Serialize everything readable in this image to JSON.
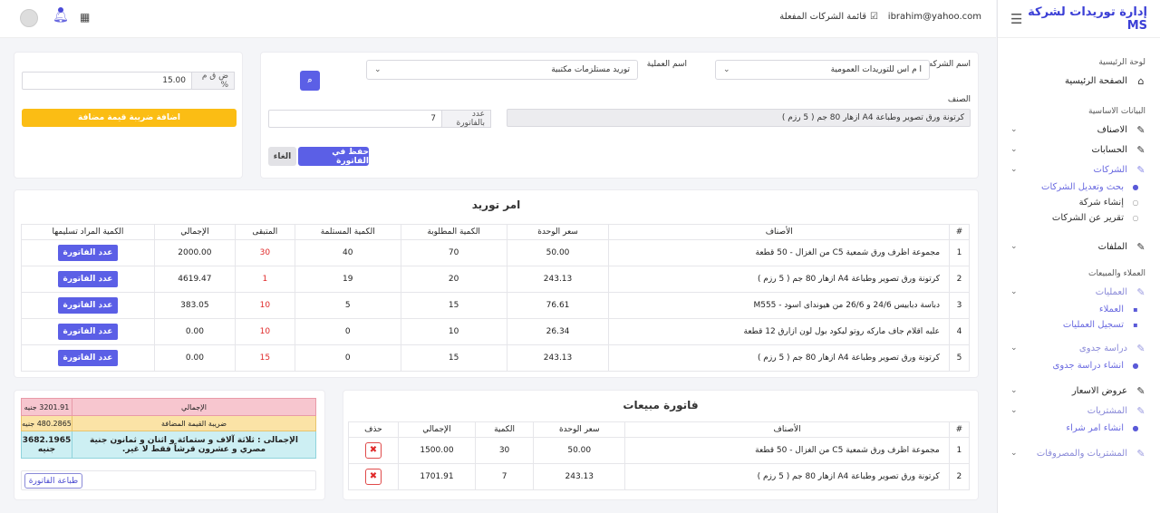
{
  "app": {
    "title": "إدارة توريدات لشركة MS"
  },
  "topbar": {
    "email": "ibrahim@yahoo.com",
    "companies_link": "قائمة الشركات المفعلة"
  },
  "sidebar": {
    "sections": [
      {
        "title": "لوحة الرئيسية"
      },
      {
        "title": "البيانات الاساسية"
      },
      {
        "title": "العملاء والمبيعات"
      }
    ],
    "home": "الصفحة الرئيسية",
    "items": {
      "categories": "الاصناف",
      "accounts": "الحسابات",
      "companies": "الشركات",
      "companies_search": "بحث وتعديل الشركات",
      "companies_create": "إنشاء شركة",
      "companies_report": "تقرير عن الشركات",
      "files": "الملفات",
      "operations": "العمليات",
      "clients": "العملاء",
      "register_ops": "تسجيل العمليات",
      "feasibility": "دراسة جدوى",
      "create_feasibility": "انشاء دراسة جدوى",
      "quotes": "عروض الاسعار",
      "purchases": "المشتريات",
      "create_po": "انشاء امر شراء",
      "purchases_expenses": "المشتريات والمصروفات"
    }
  },
  "form": {
    "company_label": "اسم الشركه",
    "company_value": "ا م اس للتوريدات العمومية",
    "operation_label": "اسم العملية",
    "operation_value": "توريد مستلزمات مكتبية",
    "item_label": "الصنف",
    "item_value": "كرتونة ورق تصوير وطباعة A4 ازهار 80 جم ( 5 رزم )",
    "count_addon": "عدد بالفاتورة",
    "count_value": "7",
    "save_button": "حفظ في الفاتورة",
    "cancel_button": "الغاء"
  },
  "vat": {
    "label": "ض ق م %",
    "value": "15.00",
    "add_button": "اضافة ضريبة قيمة مضافة"
  },
  "supply_order": {
    "title": "امر توريد",
    "columns": [
      "#",
      "الأصناف",
      "سعر الوحدة",
      "الكمية المطلوبة",
      "الكمية المستلمة",
      "المتبقى",
      "الإجمالي",
      "الكمية المراد تسليمها"
    ],
    "button_label": "عدد الفاتورة",
    "rows": [
      {
        "n": "1",
        "item": "مجموعة اظرف ورق شمعية C5 من الغزال - 50 قطعة",
        "price": "50.00",
        "req": "70",
        "recv": "40",
        "rem": "30",
        "total": "2000.00"
      },
      {
        "n": "2",
        "item": "كرتونة ورق تصوير وطباعة A4 ازهار 80 جم ( 5 رزم )",
        "price": "243.13",
        "req": "20",
        "recv": "19",
        "rem": "1",
        "total": "4619.47"
      },
      {
        "n": "3",
        "item": "دباسة دبابيس 24/6 و 26/6 من هيونداى اسود - M555",
        "price": "76.61",
        "req": "15",
        "recv": "5",
        "rem": "10",
        "total": "383.05"
      },
      {
        "n": "4",
        "item": "علبه اقلام جاف ماركه روتو ليكود بول لون ازارق 12 قطعة",
        "price": "26.34",
        "req": "10",
        "recv": "0",
        "rem": "10",
        "total": "0.00"
      },
      {
        "n": "5",
        "item": "كرتونة ورق تصوير وطباعة A4 ازهار 80 جم ( 5 رزم )",
        "price": "243.13",
        "req": "15",
        "recv": "0",
        "rem": "15",
        "total": "0.00"
      }
    ]
  },
  "sales_invoice": {
    "title": "فاتورة مبيعات",
    "columns": [
      "#",
      "الأصناف",
      "سعر الوحدة",
      "الكمية",
      "الإجمالي",
      "حذف"
    ],
    "rows": [
      {
        "n": "1",
        "item": "مجموعة اظرف ورق شمعية C5 من الغزال - 50 قطعة",
        "price": "50.00",
        "qty": "30",
        "total": "1500.00"
      },
      {
        "n": "2",
        "item": "كرتونة ورق تصوير وطباعة A4 ازهار 80 جم ( 5 رزم )",
        "price": "243.13",
        "qty": "7",
        "total": "1701.91"
      }
    ]
  },
  "summary": {
    "total_label": "الإجمالي",
    "total_value": "3201.91 جنيه",
    "vat_label": "ضريبة القيمة المضافة",
    "vat_value": "480.2865 جنيه",
    "grand_text": "الإجمالى : ثلاثة آلاف و ستمائة و اثنان و ثمانون جنية مصري و عشرون قرشاً فقط لا غير.",
    "grand_value": "3682.1965 جنيه",
    "print_button": "طباعة الفاتورة"
  },
  "colors": {
    "accent": "#5b5fe6",
    "yellow": "#fbbd14",
    "red": "#e02a2a",
    "summary_pink": "#f7c6cf",
    "summary_yellow": "#fbe3a6",
    "summary_cyan": "#cdeff3"
  }
}
